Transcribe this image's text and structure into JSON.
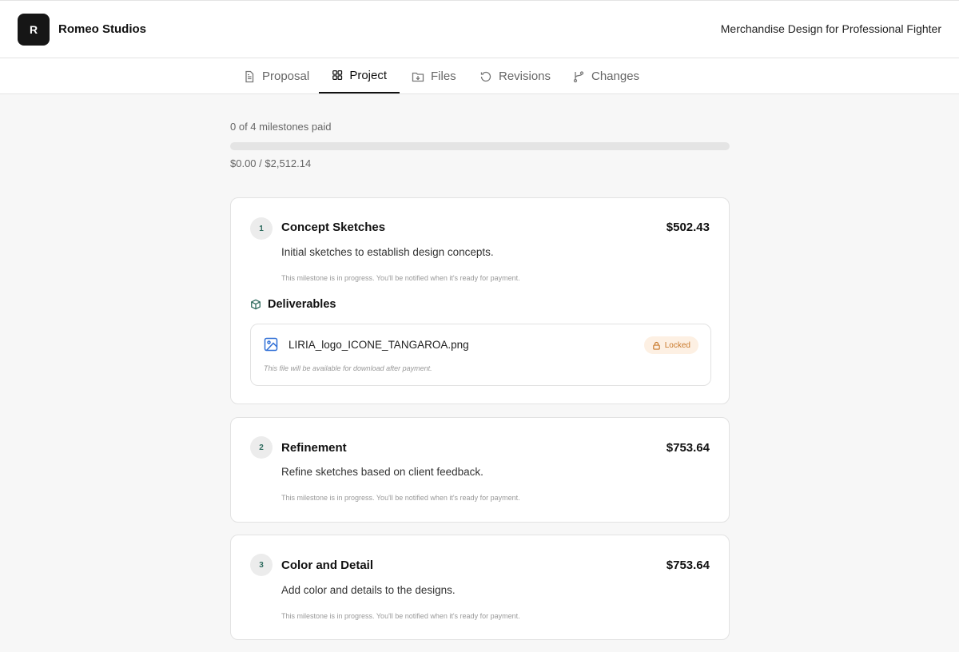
{
  "header": {
    "logo_letter": "R",
    "brand_name": "Romeo Studios",
    "project_title": "Merchandise Design for Professional Fighter"
  },
  "tabs": [
    {
      "label": "Proposal",
      "icon": "document-icon",
      "active": false
    },
    {
      "label": "Project",
      "icon": "grid-icon",
      "active": true
    },
    {
      "label": "Files",
      "icon": "folder-download-icon",
      "active": false
    },
    {
      "label": "Revisions",
      "icon": "history-icon",
      "active": false
    },
    {
      "label": "Changes",
      "icon": "git-branch-icon",
      "active": false
    }
  ],
  "progress": {
    "label": "0 of 4 milestones paid",
    "amount": "$0.00 / $2,512.14",
    "fraction": 0
  },
  "milestones": [
    {
      "number": "1",
      "title": "Concept Sketches",
      "price": "$502.43",
      "description": "Initial sketches to establish design concepts.",
      "note": "This milestone is in progress. You'll be notified when it's ready for payment.",
      "deliverables_label": "Deliverables",
      "file": {
        "name": "LIRIA_logo_ICONE_TANGAROA.png",
        "badge": "Locked",
        "note": "This file will be available for download after payment."
      }
    },
    {
      "number": "2",
      "title": "Refinement",
      "price": "$753.64",
      "description": "Refine sketches based on client feedback.",
      "note": "This milestone is in progress. You'll be notified when it's ready for payment."
    },
    {
      "number": "3",
      "title": "Color and Detail",
      "price": "$753.64",
      "description": "Add color and details to the designs.",
      "note": "This milestone is in progress. You'll be notified when it's ready for payment."
    }
  ],
  "colors": {
    "accent_teal": "#2e6b5e",
    "locked_bg": "#fdf0e3",
    "locked_text": "#c97a2c",
    "file_icon_blue": "#2f6fd6"
  }
}
